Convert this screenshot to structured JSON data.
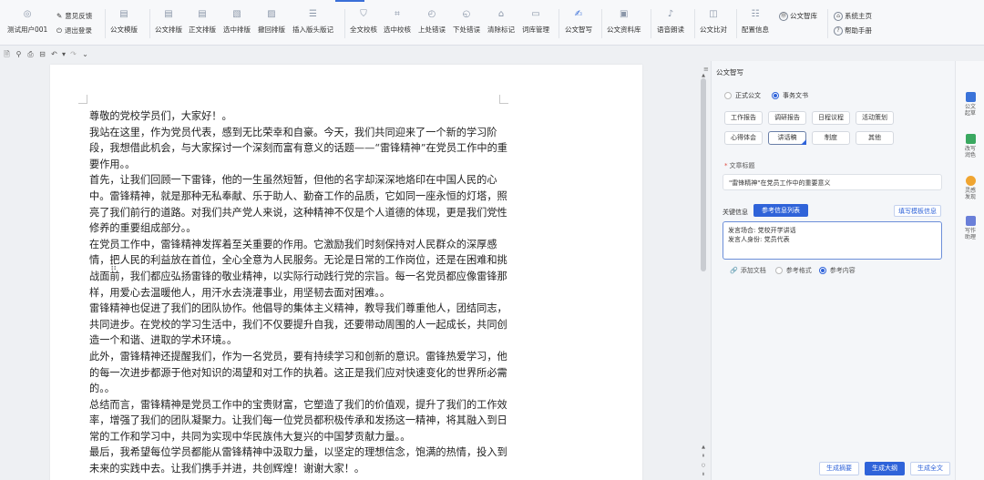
{
  "ribbon": {
    "user": {
      "name": "测试用户001",
      "feedback": "意见反馈",
      "logout": "退出登录"
    },
    "groups": [
      {
        "id": "layout",
        "label": "公文模版",
        "icon": "document-icon"
      },
      {
        "id": "format",
        "label": "公文排版",
        "icon": "document-icon"
      },
      {
        "id": "body_format",
        "label": "正文排版",
        "icon": "document-icon"
      },
      {
        "id": "sel_format",
        "label": "选中排版",
        "icon": "document-edit-icon"
      },
      {
        "id": "undo_format",
        "label": "撤回排版",
        "icon": "undo-doc-icon"
      },
      {
        "id": "insert_header",
        "label": "插入版头版记",
        "icon": "header-icon"
      },
      {
        "id": "full_check",
        "label": "全文校核",
        "icon": "shield-icon"
      },
      {
        "id": "sel_check",
        "label": "选中校核",
        "icon": "select-check-icon"
      },
      {
        "id": "prev_err",
        "label": "上处错误",
        "icon": "prev-icon"
      },
      {
        "id": "next_err",
        "label": "下处错误",
        "icon": "next-icon"
      },
      {
        "id": "clear_marks",
        "label": "清除标记",
        "icon": "eraser-icon"
      },
      {
        "id": "lexicon",
        "label": "词库管理",
        "icon": "book-icon"
      },
      {
        "id": "smart_write",
        "label": "公文智写",
        "icon": "pen-icon"
      },
      {
        "id": "material",
        "label": "公文资料库",
        "icon": "library-icon"
      },
      {
        "id": "read_aloud",
        "label": "语音朗读",
        "icon": "speaker-icon"
      },
      {
        "id": "compare",
        "label": "公文比对",
        "icon": "compare-icon"
      },
      {
        "id": "config",
        "label": "配置信息",
        "icon": "settings-list-icon"
      }
    ],
    "extra": {
      "think_tank": "公文智库",
      "home": "系统主页",
      "help": "帮助手册"
    }
  },
  "document": {
    "paragraphs": [
      "尊敬的党校学员们，大家好！。",
      "我站在这里，作为党员代表，感到无比荣幸和自豪。今天，我们共同迎来了一个新的学习阶段，我想借此机会，与大家探讨一个深刻而富有意义的话题——“雷锋精神”在党员工作中的重要作用。。",
      "首先，让我们回顾一下雷锋，他的一生虽然短暂，但他的名字却深深地烙印在中国人民的心中。雷锋精神，就是那种无私奉献、乐于助人、勤奋工作的品质，它如同一座永恒的灯塔，照亮了我们前行的道路。对我们共产党人来说，这种精神不仅是个人道德的体现，更是我们党性修养的重要组成部分。。",
      "在党员工作中，雷锋精神发挥着至关重要的作用。它激励我们时刻保持对人民群众的深厚感情，把人民的利益放在首位，全心全意为人民服务。无论是日常的工作岗位，还是在困难和挑战面前，我们都应弘扬雷锋的敬业精神，以实际行动践行党的宗旨。每一名党员都应像雷锋那样，用爱心去温暖他人，用汗水去浇灌事业，用坚韧去面对困难。。",
      "雷锋精神也促进了我们的团队协作。他倡导的集体主义精神，教导我们尊重他人，团结同志，共同进步。在党校的学习生活中，我们不仅要提升自我，还要带动周围的人一起成长，共同创造一个和谐、进取的学术环境。。",
      "此外，雷锋精神还提醒我们，作为一名党员，要有持续学习和创新的意识。雷锋热爱学习，他的每一次进步都源于他对知识的渴望和对工作的执着。这正是我们应对快速变化的世界所必需的。。",
      "总结而言，雷锋精神是党员工作中的宝贵财富，它塑造了我们的价值观，提升了我们的工作效率，增强了我们的团队凝聚力。让我们每一位党员都积极传承和发扬这一精神，将其融入到日常的工作和学习中，共同为实现中华民族伟大复兴的中国梦贡献力量。。",
      "最后，我希望每位学员都能从雷锋精神中汲取力量，以坚定的理想信念，饱满的热情，投入到未来的实践中去。让我们携手并进，共创辉煌！谢谢大家！。"
    ]
  },
  "panel": {
    "title": "公文智写",
    "doc_types": [
      {
        "label": "正式公文",
        "selected": false
      },
      {
        "label": "事务文书",
        "selected": true
      }
    ],
    "categories": [
      "工作报告",
      "调研报告",
      "日程议程",
      "活动策划",
      "心得体会",
      "讲话稿",
      "制度",
      "其他"
    ],
    "active_category": "讲话稿",
    "title_label": "文章标题",
    "title_value": "\"雷锋精神\"在党员工作中的重要意义",
    "key_info_label": "关键信息",
    "ref_info_btn": "参考信息列表",
    "fill_template_btn": "填写模板信息",
    "key_info_lines": [
      "发言场合: 党校开学讲话",
      "发言人身份: 党员代表"
    ],
    "attach_label": "添加文档",
    "ref_options": [
      {
        "label": "参考格式",
        "selected": false
      },
      {
        "label": "参考内容",
        "selected": true
      }
    ],
    "actions": {
      "summary": "生成摘要",
      "outline": "生成大纲",
      "full": "生成全文"
    }
  },
  "rail": [
    {
      "label": "公文起草",
      "color": "#3a73d9"
    },
    {
      "label": "改写润色",
      "color": "#3aa860"
    },
    {
      "label": "灵感发现",
      "color": "#f0a531"
    },
    {
      "label": "写作助理",
      "color": "#6a7fd9"
    }
  ]
}
